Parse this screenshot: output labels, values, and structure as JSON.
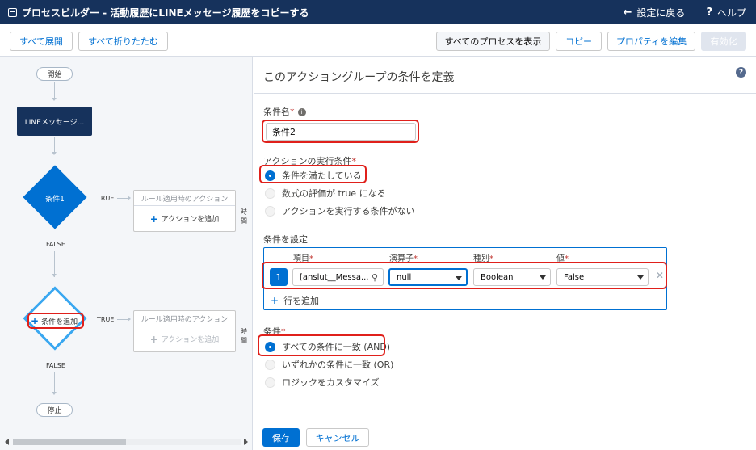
{
  "header": {
    "title": "プロセスビルダー - 活動履歴にLINEメッセージ履歴をコピーする",
    "back_label": "設定に戻る",
    "help_label": "ヘルプ"
  },
  "toolbar": {
    "expand_all": "すべて展開",
    "collapse_all": "すべて折りたたむ",
    "view_all_processes": "すべてのプロセスを表示",
    "copy": "コピー",
    "edit_properties": "プロパティを編集",
    "activate": "有効化"
  },
  "canvas": {
    "start": "開始",
    "object_node": "LINEメッセージ...",
    "criteria1_label": "条件1",
    "true1": "TRUE",
    "false1": "FALSE",
    "action1_header": "ルール適用時のアクション",
    "action1_add": "アクションを追加",
    "scheduled1": "時間",
    "criteria2_add": "条件を追加",
    "true2": "TRUE",
    "false2": "FALSE",
    "action2_header": "ルール適用時のアクション",
    "action2_add": "アクションを追加",
    "scheduled2": "時間",
    "stop": "停止"
  },
  "panel": {
    "title": "このアクショングループの条件を定義",
    "criteria_name_label": "条件名",
    "criteria_name_value": "条件2",
    "execute_label": "アクションの実行条件",
    "execute_options": [
      "条件を満たしている",
      "数式の評価が true になる",
      "アクションを実行する条件がない"
    ],
    "execute_selected": 0,
    "set_conditions_label": "条件を設定",
    "columns": {
      "field": "項目",
      "operator": "演算子",
      "type": "種別",
      "value": "値"
    },
    "row": {
      "num": "1",
      "field": "[anslut__Messa...",
      "operator": "null",
      "type": "Boolean",
      "value": "False"
    },
    "add_row": "行を追加",
    "conditions_label": "条件",
    "logic_options": [
      "すべての条件に一致 (AND)",
      "いずれかの条件に一致 (OR)",
      "ロジックをカスタマイズ"
    ],
    "logic_selected": 0,
    "save": "保存",
    "cancel": "キャンセル"
  },
  "colors": {
    "header_bg": "#16325c",
    "brand_blue": "#0070d2",
    "highlight_red": "#e0201b",
    "canvas_bg": "#f4f6f9"
  }
}
